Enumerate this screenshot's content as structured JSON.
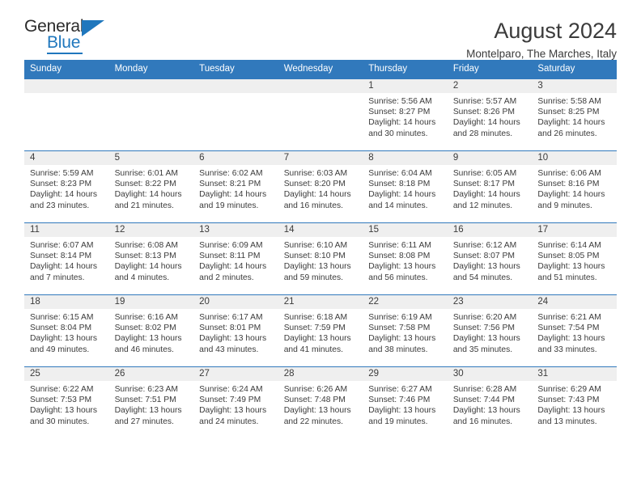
{
  "brand": {
    "name_part1": "General",
    "name_part2": "Blue",
    "accent_color": "#1f77bd"
  },
  "header": {
    "title": "August 2024",
    "subtitle": "Montelparo, The Marches, Italy"
  },
  "calendar": {
    "header_bg": "#3179bc",
    "daynum_bg": "#efefef",
    "weekday_headers": [
      "Sunday",
      "Monday",
      "Tuesday",
      "Wednesday",
      "Thursday",
      "Friday",
      "Saturday"
    ],
    "labels": {
      "sunrise": "Sunrise:",
      "sunset": "Sunset:",
      "daylight": "Daylight:"
    },
    "weeks": [
      [
        {
          "day": "",
          "empty": true
        },
        {
          "day": "",
          "empty": true
        },
        {
          "day": "",
          "empty": true
        },
        {
          "day": "",
          "empty": true
        },
        {
          "day": "1",
          "sunrise": "Sunrise: 5:56 AM",
          "sunset": "Sunset: 8:27 PM",
          "daylight_line1": "Daylight: 14 hours",
          "daylight_line2": "and 30 minutes."
        },
        {
          "day": "2",
          "sunrise": "Sunrise: 5:57 AM",
          "sunset": "Sunset: 8:26 PM",
          "daylight_line1": "Daylight: 14 hours",
          "daylight_line2": "and 28 minutes."
        },
        {
          "day": "3",
          "sunrise": "Sunrise: 5:58 AM",
          "sunset": "Sunset: 8:25 PM",
          "daylight_line1": "Daylight: 14 hours",
          "daylight_line2": "and 26 minutes."
        }
      ],
      [
        {
          "day": "4",
          "sunrise": "Sunrise: 5:59 AM",
          "sunset": "Sunset: 8:23 PM",
          "daylight_line1": "Daylight: 14 hours",
          "daylight_line2": "and 23 minutes."
        },
        {
          "day": "5",
          "sunrise": "Sunrise: 6:01 AM",
          "sunset": "Sunset: 8:22 PM",
          "daylight_line1": "Daylight: 14 hours",
          "daylight_line2": "and 21 minutes."
        },
        {
          "day": "6",
          "sunrise": "Sunrise: 6:02 AM",
          "sunset": "Sunset: 8:21 PM",
          "daylight_line1": "Daylight: 14 hours",
          "daylight_line2": "and 19 minutes."
        },
        {
          "day": "7",
          "sunrise": "Sunrise: 6:03 AM",
          "sunset": "Sunset: 8:20 PM",
          "daylight_line1": "Daylight: 14 hours",
          "daylight_line2": "and 16 minutes."
        },
        {
          "day": "8",
          "sunrise": "Sunrise: 6:04 AM",
          "sunset": "Sunset: 8:18 PM",
          "daylight_line1": "Daylight: 14 hours",
          "daylight_line2": "and 14 minutes."
        },
        {
          "day": "9",
          "sunrise": "Sunrise: 6:05 AM",
          "sunset": "Sunset: 8:17 PM",
          "daylight_line1": "Daylight: 14 hours",
          "daylight_line2": "and 12 minutes."
        },
        {
          "day": "10",
          "sunrise": "Sunrise: 6:06 AM",
          "sunset": "Sunset: 8:16 PM",
          "daylight_line1": "Daylight: 14 hours",
          "daylight_line2": "and 9 minutes."
        }
      ],
      [
        {
          "day": "11",
          "sunrise": "Sunrise: 6:07 AM",
          "sunset": "Sunset: 8:14 PM",
          "daylight_line1": "Daylight: 14 hours",
          "daylight_line2": "and 7 minutes."
        },
        {
          "day": "12",
          "sunrise": "Sunrise: 6:08 AM",
          "sunset": "Sunset: 8:13 PM",
          "daylight_line1": "Daylight: 14 hours",
          "daylight_line2": "and 4 minutes."
        },
        {
          "day": "13",
          "sunrise": "Sunrise: 6:09 AM",
          "sunset": "Sunset: 8:11 PM",
          "daylight_line1": "Daylight: 14 hours",
          "daylight_line2": "and 2 minutes."
        },
        {
          "day": "14",
          "sunrise": "Sunrise: 6:10 AM",
          "sunset": "Sunset: 8:10 PM",
          "daylight_line1": "Daylight: 13 hours",
          "daylight_line2": "and 59 minutes."
        },
        {
          "day": "15",
          "sunrise": "Sunrise: 6:11 AM",
          "sunset": "Sunset: 8:08 PM",
          "daylight_line1": "Daylight: 13 hours",
          "daylight_line2": "and 56 minutes."
        },
        {
          "day": "16",
          "sunrise": "Sunrise: 6:12 AM",
          "sunset": "Sunset: 8:07 PM",
          "daylight_line1": "Daylight: 13 hours",
          "daylight_line2": "and 54 minutes."
        },
        {
          "day": "17",
          "sunrise": "Sunrise: 6:14 AM",
          "sunset": "Sunset: 8:05 PM",
          "daylight_line1": "Daylight: 13 hours",
          "daylight_line2": "and 51 minutes."
        }
      ],
      [
        {
          "day": "18",
          "sunrise": "Sunrise: 6:15 AM",
          "sunset": "Sunset: 8:04 PM",
          "daylight_line1": "Daylight: 13 hours",
          "daylight_line2": "and 49 minutes."
        },
        {
          "day": "19",
          "sunrise": "Sunrise: 6:16 AM",
          "sunset": "Sunset: 8:02 PM",
          "daylight_line1": "Daylight: 13 hours",
          "daylight_line2": "and 46 minutes."
        },
        {
          "day": "20",
          "sunrise": "Sunrise: 6:17 AM",
          "sunset": "Sunset: 8:01 PM",
          "daylight_line1": "Daylight: 13 hours",
          "daylight_line2": "and 43 minutes."
        },
        {
          "day": "21",
          "sunrise": "Sunrise: 6:18 AM",
          "sunset": "Sunset: 7:59 PM",
          "daylight_line1": "Daylight: 13 hours",
          "daylight_line2": "and 41 minutes."
        },
        {
          "day": "22",
          "sunrise": "Sunrise: 6:19 AM",
          "sunset": "Sunset: 7:58 PM",
          "daylight_line1": "Daylight: 13 hours",
          "daylight_line2": "and 38 minutes."
        },
        {
          "day": "23",
          "sunrise": "Sunrise: 6:20 AM",
          "sunset": "Sunset: 7:56 PM",
          "daylight_line1": "Daylight: 13 hours",
          "daylight_line2": "and 35 minutes."
        },
        {
          "day": "24",
          "sunrise": "Sunrise: 6:21 AM",
          "sunset": "Sunset: 7:54 PM",
          "daylight_line1": "Daylight: 13 hours",
          "daylight_line2": "and 33 minutes."
        }
      ],
      [
        {
          "day": "25",
          "sunrise": "Sunrise: 6:22 AM",
          "sunset": "Sunset: 7:53 PM",
          "daylight_line1": "Daylight: 13 hours",
          "daylight_line2": "and 30 minutes."
        },
        {
          "day": "26",
          "sunrise": "Sunrise: 6:23 AM",
          "sunset": "Sunset: 7:51 PM",
          "daylight_line1": "Daylight: 13 hours",
          "daylight_line2": "and 27 minutes."
        },
        {
          "day": "27",
          "sunrise": "Sunrise: 6:24 AM",
          "sunset": "Sunset: 7:49 PM",
          "daylight_line1": "Daylight: 13 hours",
          "daylight_line2": "and 24 minutes."
        },
        {
          "day": "28",
          "sunrise": "Sunrise: 6:26 AM",
          "sunset": "Sunset: 7:48 PM",
          "daylight_line1": "Daylight: 13 hours",
          "daylight_line2": "and 22 minutes."
        },
        {
          "day": "29",
          "sunrise": "Sunrise: 6:27 AM",
          "sunset": "Sunset: 7:46 PM",
          "daylight_line1": "Daylight: 13 hours",
          "daylight_line2": "and 19 minutes."
        },
        {
          "day": "30",
          "sunrise": "Sunrise: 6:28 AM",
          "sunset": "Sunset: 7:44 PM",
          "daylight_line1": "Daylight: 13 hours",
          "daylight_line2": "and 16 minutes."
        },
        {
          "day": "31",
          "sunrise": "Sunrise: 6:29 AM",
          "sunset": "Sunset: 7:43 PM",
          "daylight_line1": "Daylight: 13 hours",
          "daylight_line2": "and 13 minutes."
        }
      ]
    ]
  }
}
